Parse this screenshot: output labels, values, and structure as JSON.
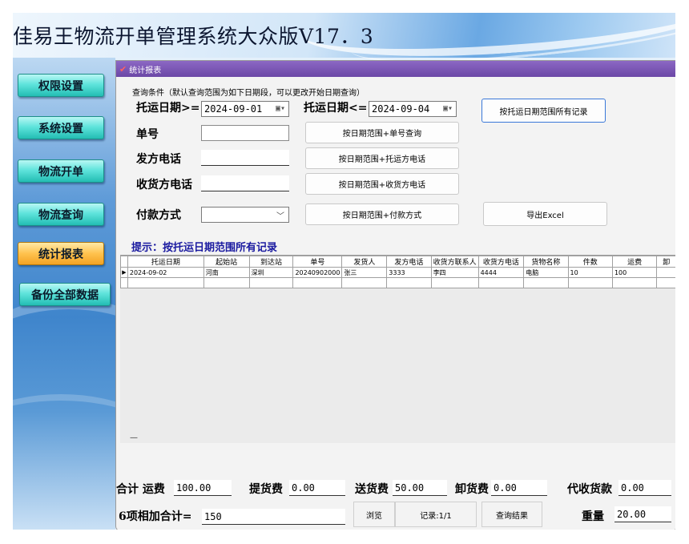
{
  "app": {
    "title": "佳易王物流开单管理系统大众版V17.3",
    "title_text": "佳易王物流开单管理系统大众版V17．3"
  },
  "sidebar": {
    "items": [
      {
        "label": "权限设置"
      },
      {
        "label": "系统设置"
      },
      {
        "label": "物流开单"
      },
      {
        "label": "物流查询"
      },
      {
        "label": "统计报表"
      },
      {
        "label": "备份全部数据"
      }
    ],
    "active": "统计报表"
  },
  "panel": {
    "title": "统计报表",
    "query_note": "查询条件（默认查询范围为如下日期段，可以更改开始日期查询）",
    "date_from_label": "托运日期>=",
    "date_from_value": "2024-09-01",
    "date_to_label": "托运日期<=",
    "date_to_value": "2024-09-04",
    "order_no_label": "单号",
    "order_no_value": "",
    "sender_phone_label": "发方电话",
    "sender_phone_value": "",
    "receiver_phone_label": "收货方电话",
    "receiver_phone_value": "",
    "payment_label": "付款方式",
    "payment_value": "",
    "buttons": {
      "all_in_range": "按托运日期范围所有记录",
      "by_order_no": "按日期范围+单号查询",
      "by_sender_phone": "按日期范围+托运方电话",
      "by_receiver_phone": "按日期范围+收货方电话",
      "by_payment": "按日期范围+付款方式",
      "export_excel": "导出Excel"
    },
    "hint": "提示：按托运日期范围所有记录"
  },
  "table": {
    "columns": [
      "托运日期",
      "起始站",
      "到达站",
      "单号",
      "发货人",
      "发方电话",
      "收货方联系人",
      "收货方电话",
      "货物名称",
      "件数",
      "运费",
      "卸"
    ],
    "rows": [
      [
        "2024-09-02",
        "河南",
        "深圳",
        "20240902000",
        "张三",
        "3333",
        "李四",
        "4444",
        "电脑",
        "10",
        "100",
        ""
      ]
    ],
    "row_indicator": "▶",
    "pager_dash": "—"
  },
  "summary": {
    "total_freight_label": "合计 运费",
    "total_freight": "100.00",
    "pickup_fee_label": "提货费",
    "pickup_fee": "0.00",
    "delivery_fee_label": "送货费",
    "delivery_fee": "50.00",
    "unload_fee_label": "卸货费",
    "unload_fee": "0.00",
    "cod_label": "代收货款",
    "cod": "0.00",
    "six_sum_label": "6项相加合计=",
    "six_sum": "150",
    "browse_label": "浏览",
    "record_label": "记录:1/1",
    "query_result_label": "查询结果",
    "weight_label": "重量",
    "weight": "20.00"
  },
  "icons": {
    "panel_header": "report-icon",
    "calendar": "calendar-icon",
    "dropdown": "chevron-down-icon",
    "row_pointer": "row-pointer-icon"
  },
  "colors": {
    "panel_header": "#7a56b6",
    "nav_button": "#4fd8d0",
    "nav_active": "#ffc24e",
    "hint_text": "#1a1aa0"
  }
}
